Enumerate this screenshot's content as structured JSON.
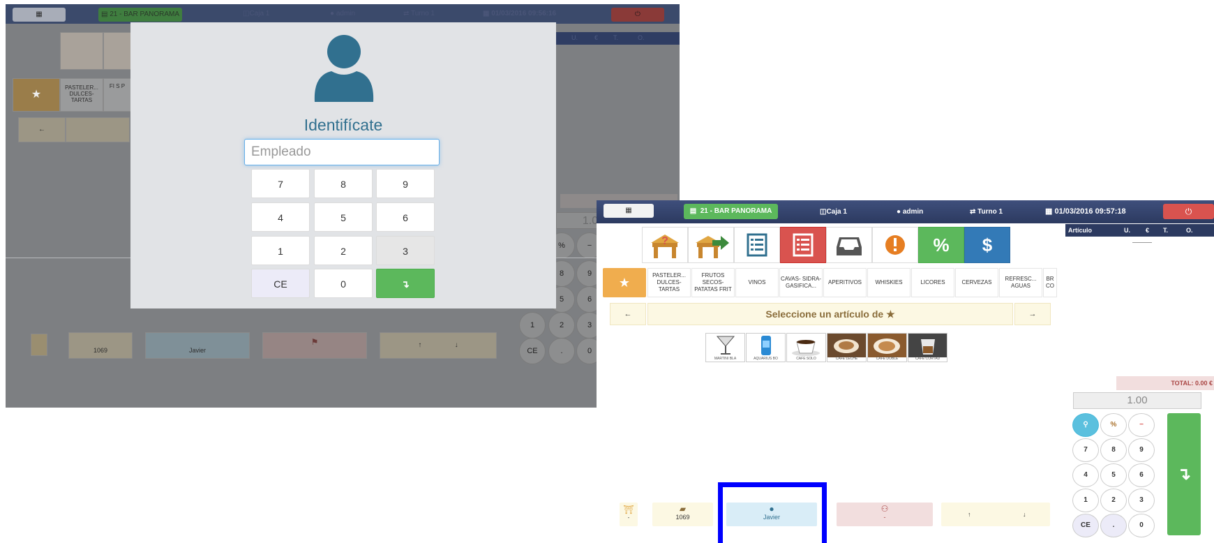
{
  "header": {
    "menu_icon": "grid-icon",
    "bar_label": "21 - BAR PANORAMA",
    "caja": "Caja 1",
    "user": "admin",
    "turno": "Turno 1",
    "datetime_left": "01/03/2016 09:56:16",
    "datetime_right": "01/03/2016 09:57:18",
    "power_icon": "power-icon"
  },
  "modal": {
    "title": "Identifícate",
    "input_placeholder": "Empleado",
    "keys": [
      "7",
      "8",
      "9",
      "4",
      "5",
      "6",
      "1",
      "2",
      "3",
      "CE",
      "0",
      "↴"
    ]
  },
  "order_table": {
    "headers": [
      "Artículo",
      "U.",
      "€",
      "T.",
      "O."
    ]
  },
  "toolbar_icons": [
    "help-table-icon",
    "transfer-table-icon",
    "list-icon",
    "red-list-icon",
    "inbox-icon",
    "alert-icon",
    "percent-icon",
    "dollar-icon"
  ],
  "categories": [
    "PASTELER... DULCES- TARTAS",
    "FRUTOS SECOS- PATATAS FRIT",
    "VINOS",
    "CAVAS- SIDRA- GASIFICA...",
    "APERITIVOS",
    "WHISKIES",
    "LICORES",
    "CERVEZAS",
    "REFRESC... AGUAS",
    "BR CO"
  ],
  "left_categories": [
    "PASTELER... DULCES- TARTAS",
    "FI S P"
  ],
  "prompt": "Seleccione un artículo de ★",
  "products": [
    "MARTINI BLA",
    "AQUARIUS BO",
    "CAFE SOLO",
    "CAFE LECHE",
    "CAFE DOBLE",
    "CAFE CORTAD"
  ],
  "total": {
    "label": "TOTAL: 0.00 €",
    "qty": "1.00"
  },
  "numpad": {
    "rows": [
      [
        "%",
        "−"
      ],
      [
        "7",
        "8",
        "9"
      ],
      [
        "4",
        "5",
        "6"
      ],
      [
        "1",
        "2",
        "3"
      ],
      [
        "CE",
        ".",
        "0"
      ]
    ]
  },
  "left_numpad_visible": [
    "%",
    "−",
    "8",
    "9",
    "5",
    "6",
    "1",
    "2",
    "3",
    "CE",
    ".",
    "0"
  ],
  "footer": {
    "table_dash": "-",
    "ticket_number": "1069",
    "waiter": "Javier",
    "diners": "-",
    "up": "↑",
    "down": "↓"
  },
  "colors": {
    "header": "#3b4a6b",
    "green": "#5cb85c",
    "red": "#d9534f",
    "blue_icon": "#31708f",
    "highlight_box": "#0000ff"
  }
}
